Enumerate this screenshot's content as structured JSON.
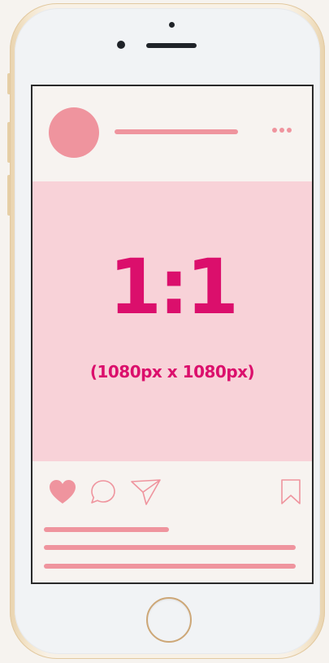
{
  "post": {
    "ratio": "1:1",
    "dimensions": "(1080px x 1080px)"
  },
  "icons": {
    "like": "heart-icon",
    "comment": "comment-icon",
    "share": "send-icon",
    "save": "bookmark-icon",
    "more": "more-dots-icon"
  },
  "colors": {
    "accent_pink": "#ef949e",
    "text_magenta": "#db0f6c",
    "image_background": "#f8d2d8",
    "screen_background": "#f7f3f0"
  }
}
